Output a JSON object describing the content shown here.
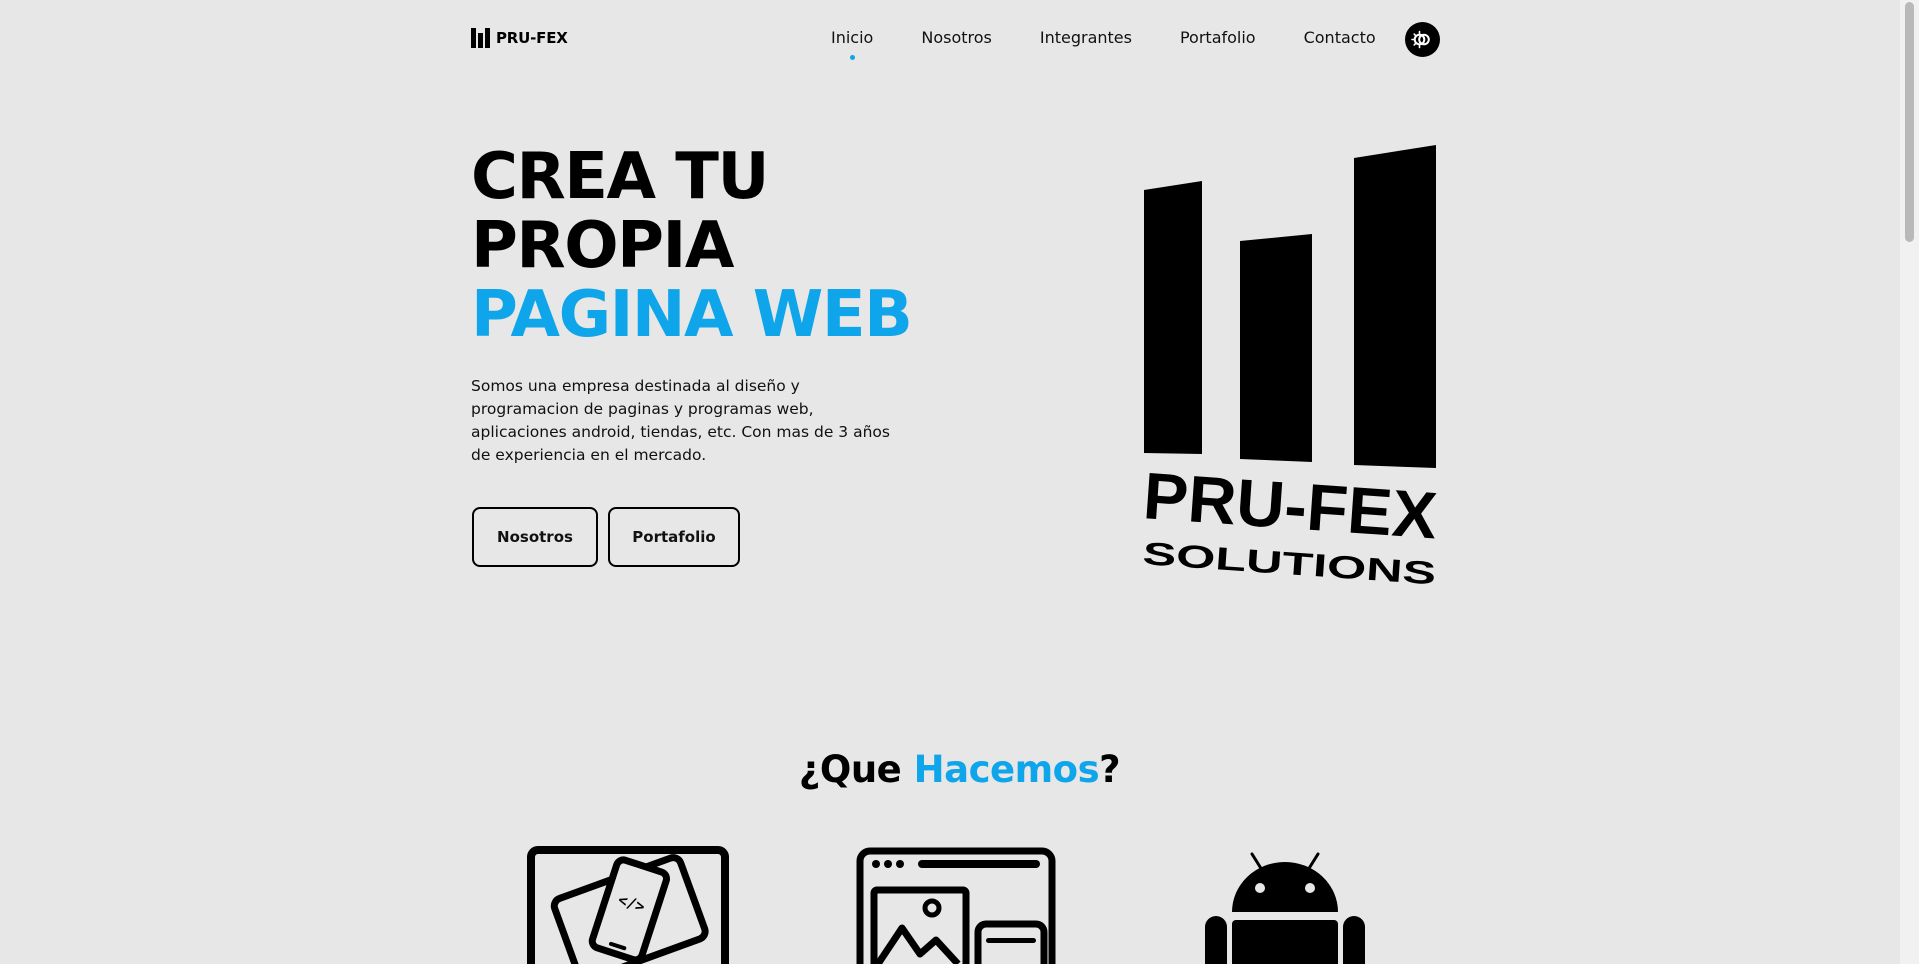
{
  "header": {
    "brand_text": "PRU-FEX",
    "nav": [
      {
        "label": "Inicio",
        "active": true
      },
      {
        "label": "Nosotros",
        "active": false
      },
      {
        "label": "Integrantes",
        "active": false
      },
      {
        "label": "Portafolio",
        "active": false
      },
      {
        "label": "Contacto",
        "active": false
      }
    ],
    "theme_toggle_icon": "theme-toggle-icon"
  },
  "hero": {
    "title_line1": "CREA TU",
    "title_line2": "PROPIA",
    "title_line3": "PAGINA WEB",
    "description": "Somos una empresa destinada al diseño y programacion de paginas y programas web, aplicaciones android, tiendas, etc. Con mas de 3 años de experiencia en el mercado.",
    "buttons": [
      "Nosotros",
      "Portafolio"
    ],
    "logo_text_main": "PRU-FEX",
    "logo_text_sub": "SOLUTIONS"
  },
  "services_section": {
    "title_prefix": "¿Que ",
    "title_accent": "Hacemos",
    "title_suffix": "?",
    "icons": [
      "responsive-devices-icon",
      "web-design-icon",
      "android-icon"
    ]
  },
  "colors": {
    "background": "#e7e7e7",
    "accent": "#0ea5ea",
    "text": "#000000"
  }
}
